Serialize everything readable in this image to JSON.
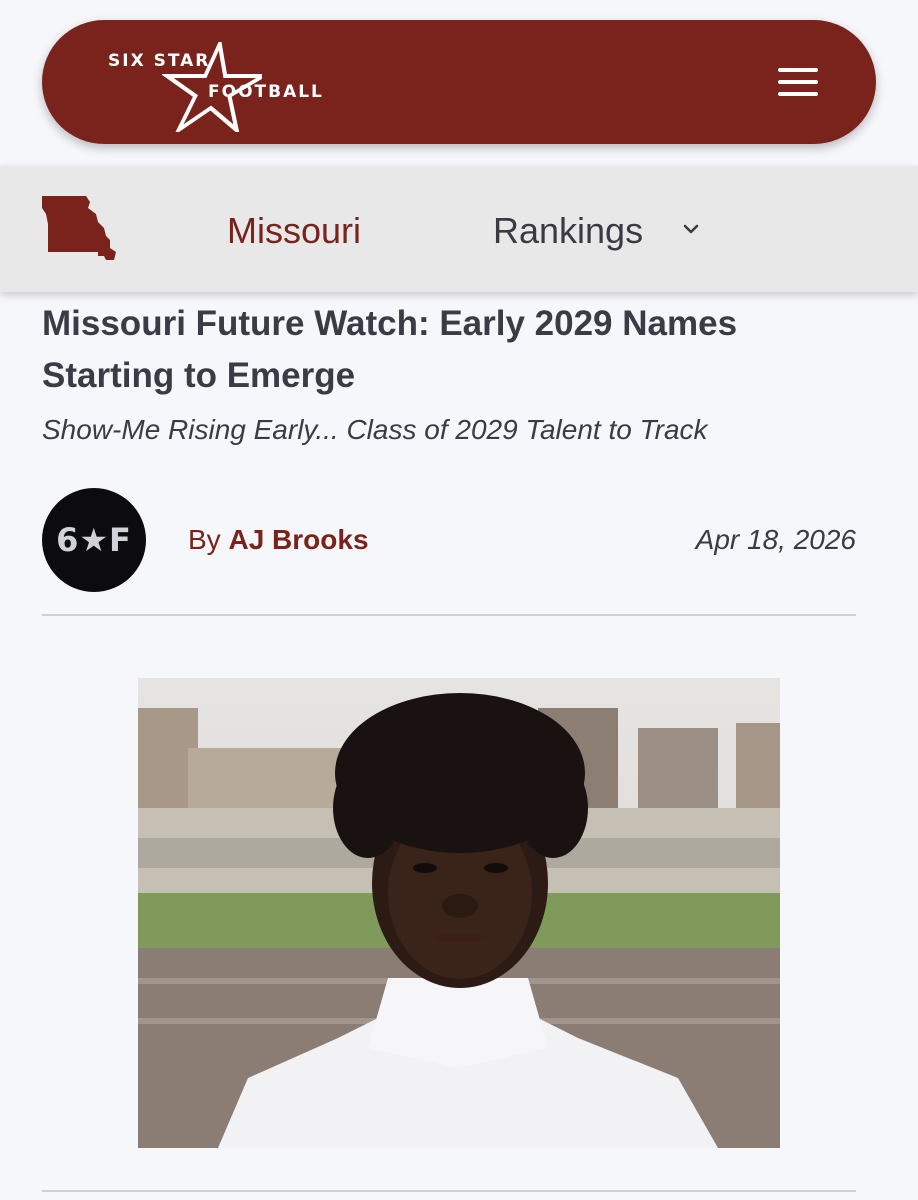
{
  "header": {
    "logo_top": "SIX STAR",
    "logo_bottom": "FOOTBALL",
    "brand_color": "#7a231d",
    "menu_icon": "hamburger-menu-icon"
  },
  "subnav": {
    "state_icon": "missouri-map-icon",
    "state_label": "Missouri",
    "rankings_label": "Rankings",
    "rankings_icon": "chevron-down-icon"
  },
  "article": {
    "title": "Missouri Future Watch: Early 2029 Names Starting to Emerge",
    "subtitle": "Show-Me Rising Early... Class of 2029 Talent to Track",
    "avatar_text": "6★F",
    "by_label": "By",
    "author": "AJ Brooks",
    "date": "Apr 18, 2026"
  }
}
